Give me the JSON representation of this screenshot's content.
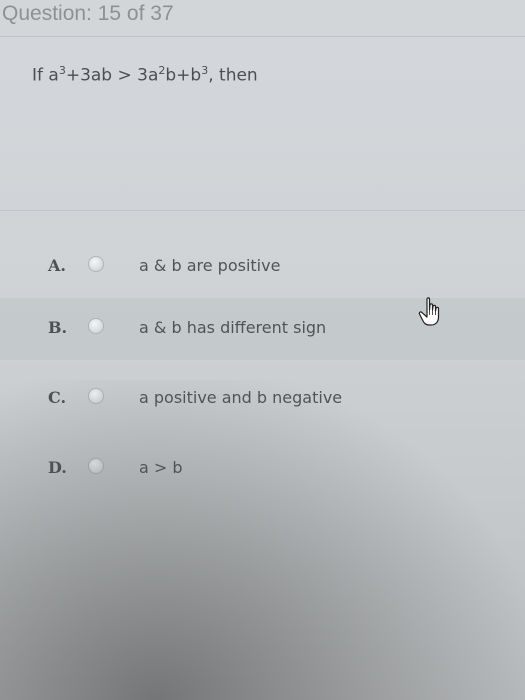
{
  "header": {
    "question_counter": "Question: 15 of 37"
  },
  "question": {
    "prefix": "If a",
    "sup1": "3",
    "mid1": "+3ab > 3a",
    "sup2": "2",
    "mid2": "b+b",
    "sup3": "3",
    "suffix": ", then"
  },
  "options": [
    {
      "letter": "A.",
      "text": "a & b are positive"
    },
    {
      "letter": "B.",
      "text": "a & b has different sign"
    },
    {
      "letter": "C.",
      "text": "a positive and b negative"
    },
    {
      "letter": "D.",
      "text": "a > b"
    }
  ],
  "cursor_icon": "hand-pointer-icon"
}
